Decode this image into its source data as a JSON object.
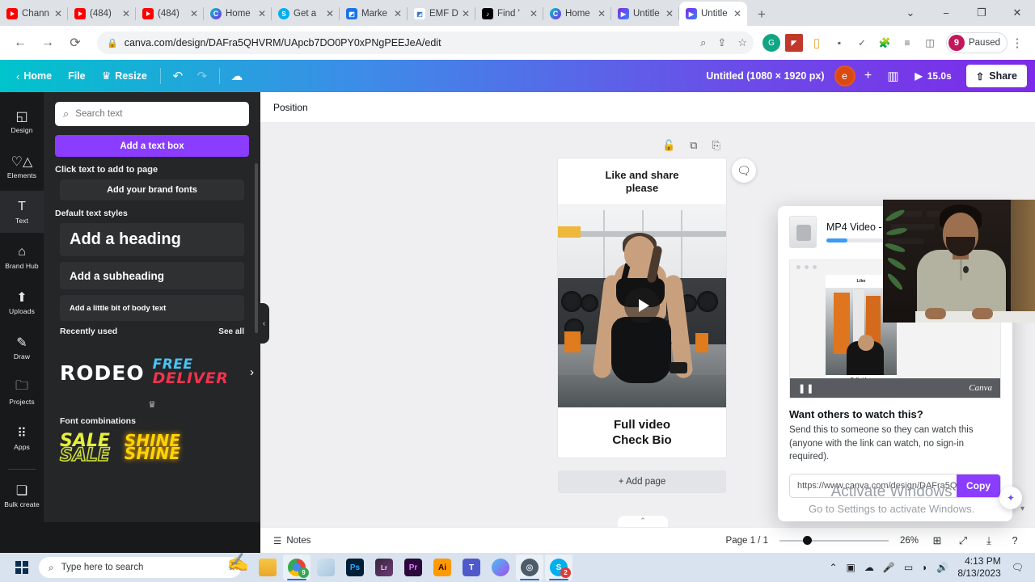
{
  "browser": {
    "tabs": [
      {
        "title": "Chann",
        "favicon": "youtube-icon",
        "active": false
      },
      {
        "title": "(484) ",
        "favicon": "youtube-icon",
        "active": false
      },
      {
        "title": "(484) ",
        "favicon": "youtube-icon",
        "active": false
      },
      {
        "title": "Home",
        "favicon": "canva-icon",
        "active": false
      },
      {
        "title": "Get a",
        "favicon": "skype-icon",
        "active": false
      },
      {
        "title": "Marke",
        "favicon": "marketplace-icon",
        "active": false
      },
      {
        "title": "EMF D",
        "favicon": "emf-icon",
        "active": false
      },
      {
        "title": "Find '",
        "favicon": "tiktok-icon",
        "active": false
      },
      {
        "title": "Home",
        "favicon": "canva-icon",
        "active": false
      },
      {
        "title": "Untitle",
        "favicon": "canva-video-icon",
        "active": false
      },
      {
        "title": "Untitle",
        "favicon": "canva-video-icon",
        "active": true
      }
    ],
    "new_tab_label": "+",
    "tab_list_chevron": "⌄",
    "window_controls": {
      "minimize": "−",
      "maximize": "❐",
      "close": "✕"
    },
    "nav": {
      "back": "←",
      "forward": "→",
      "reload": "⟳"
    },
    "omnibox": {
      "lock_icon": "lock-icon",
      "url": "canva.com/design/DAFra5QHVRM/UApcb7DO0PY0xPNgPEEJeA/edit",
      "zoom_icon": "zoom-icon",
      "share_icon": "share-icon",
      "bookmark_icon": "star-icon"
    },
    "extensions": [
      "grammarly-icon",
      "red-extension-icon",
      "lastpass-icon",
      "gray-extension-icon",
      "check-icon",
      "puzzle-icon",
      "reading-list-icon",
      "side-panel-icon"
    ],
    "profile": {
      "initial": "9",
      "label": "Paused"
    },
    "menu_icon": "kebab-menu-icon"
  },
  "canva": {
    "topbar": {
      "back_chevron": "‹",
      "home_label": "Home",
      "file_label": "File",
      "resize_label": "Resize",
      "resize_icon": "crown-icon",
      "undo_icon": "undo-icon",
      "redo_icon": "redo-icon",
      "cloud_icon": "cloud-saved-icon",
      "doc_title": "Untitled (1080 × 1920 px)",
      "avatar_initial": "e",
      "add_collaborator": "+",
      "insights_icon": "insights-icon",
      "play_icon": "play-icon",
      "duration": "15.0s",
      "share_icon": "upload-icon",
      "share_label": "Share"
    },
    "rail": [
      {
        "label": "Design",
        "icon": "design-icon",
        "active": false
      },
      {
        "label": "Elements",
        "icon": "elements-icon",
        "active": false
      },
      {
        "label": "Text",
        "icon": "text-icon",
        "active": true
      },
      {
        "label": "Brand Hub",
        "icon": "brand-hub-icon",
        "active": false
      },
      {
        "label": "Uploads",
        "icon": "uploads-icon",
        "active": false
      },
      {
        "label": "Draw",
        "icon": "draw-icon",
        "active": false
      },
      {
        "label": "Projects",
        "icon": "projects-icon",
        "active": false
      },
      {
        "label": "Apps",
        "icon": "apps-icon",
        "active": false
      },
      {
        "label": "Bulk create",
        "icon": "bulk-create-icon",
        "active": false
      }
    ],
    "text_panel": {
      "search_placeholder": "Search text",
      "search_icon": "search-icon",
      "add_text_box": "Add a text box",
      "click_text_label": "Click text to add to page",
      "brand_fonts": "Add your brand fonts",
      "default_styles_label": "Default text styles",
      "heading": "Add a heading",
      "subheading": "Add a subheading",
      "body": "Add a little bit of body text",
      "recently_used_label": "Recently used",
      "see_all": "See all",
      "recent_1": "RODEO",
      "recent_2_line1": "FREE",
      "recent_2_line2": "DELIVER",
      "crown_icon": "crown-icon",
      "font_combinations_label": "Font combinations",
      "combo_1_line1": "SALE",
      "combo_1_line2": "SALE",
      "combo_2_line1": "SHINE",
      "combo_2_line2": "SHINE",
      "collapse_icon": "chevron-left-icon"
    },
    "editor": {
      "position_label": "Position",
      "page_tools": [
        "lock-icon",
        "duplicate-icon",
        "add-page-icon"
      ],
      "comment_icon": "comment-add-icon",
      "add_page_label": "+ Add page",
      "design": {
        "top_line1": "Like and share",
        "top_line2": "please",
        "bottom_line1": "Full video",
        "bottom_line2": "Check Bio",
        "play_icon": "play-icon"
      },
      "bottom_tab_icon": "⌃"
    },
    "share_dialog": {
      "filename": "MP4 Video -",
      "thumb_icon": "video-thumbnail",
      "preview": {
        "top_text": "Like",
        "bottom_line1": "Full video",
        "bottom_line2": "Check Bio",
        "pause_icon": "pause-icon",
        "watermark": "Canva"
      },
      "heading": "Want others to watch this?",
      "body": "Send this to someone so they can watch this (anyone with the link can watch, no sign-in required).",
      "link": "https://www.canva.com/design/DAFra5Q",
      "copy_label": "Copy",
      "magic_icon": "magic-sparkle-icon",
      "scroll_arrow_icon": "chevron-down-icon"
    },
    "statusbar": {
      "notes_icon": "notes-icon",
      "notes_label": "Notes",
      "page_label": "Page 1 / 1",
      "zoom_percent": "26%",
      "grid_icon": "grid-view-icon",
      "fullscreen_icon": "fullscreen-icon",
      "download_icon": "download-icon",
      "help_icon": "help-icon"
    }
  },
  "watermark": {
    "line1": "Activate Windows",
    "line2": "Go to Settings to activate Windows."
  },
  "taskbar": {
    "start_icon": "windows-start-icon",
    "search_icon": "search-icon",
    "search_placeholder": "Type here to search",
    "cursor_icon": "hand-pen-cursor",
    "apps": [
      {
        "name": "file-explorer-icon",
        "label": "",
        "active": false,
        "badge": ""
      },
      {
        "name": "chrome-icon",
        "label": "",
        "active": true,
        "badge": "9"
      },
      {
        "name": "sticky-notes-icon",
        "label": "",
        "active": false,
        "badge": ""
      },
      {
        "name": "photoshop-icon",
        "label": "Ps",
        "active": false,
        "badge": ""
      },
      {
        "name": "lightroom-icon",
        "label": "Lr",
        "active": false,
        "badge": ""
      },
      {
        "name": "premiere-icon",
        "label": "Pr",
        "active": false,
        "badge": ""
      },
      {
        "name": "illustrator-icon",
        "label": "Ai",
        "active": false,
        "badge": ""
      },
      {
        "name": "teams-icon",
        "label": "",
        "active": false,
        "badge": ""
      },
      {
        "name": "copilot-icon",
        "label": "",
        "active": false,
        "badge": ""
      },
      {
        "name": "bittorrent-icon",
        "label": "",
        "active": true,
        "badge": ""
      },
      {
        "name": "skype-icon",
        "label": "",
        "active": true,
        "badge": "2"
      }
    ],
    "tray": [
      "chevron-up-icon",
      "meet-now-icon",
      "onedrive-icon",
      "mic-icon",
      "battery-icon",
      "wifi-icon",
      "volume-icon"
    ],
    "clock_time": "4:13 PM",
    "clock_date": "8/13/2023",
    "notification_icon": "notifications-icon"
  },
  "colors": {
    "canva_purple": "#8b3dff",
    "canva_teal": "#00c4cc",
    "accent_blue": "#3b9bf5",
    "taskbar": "#d8e3ef"
  }
}
